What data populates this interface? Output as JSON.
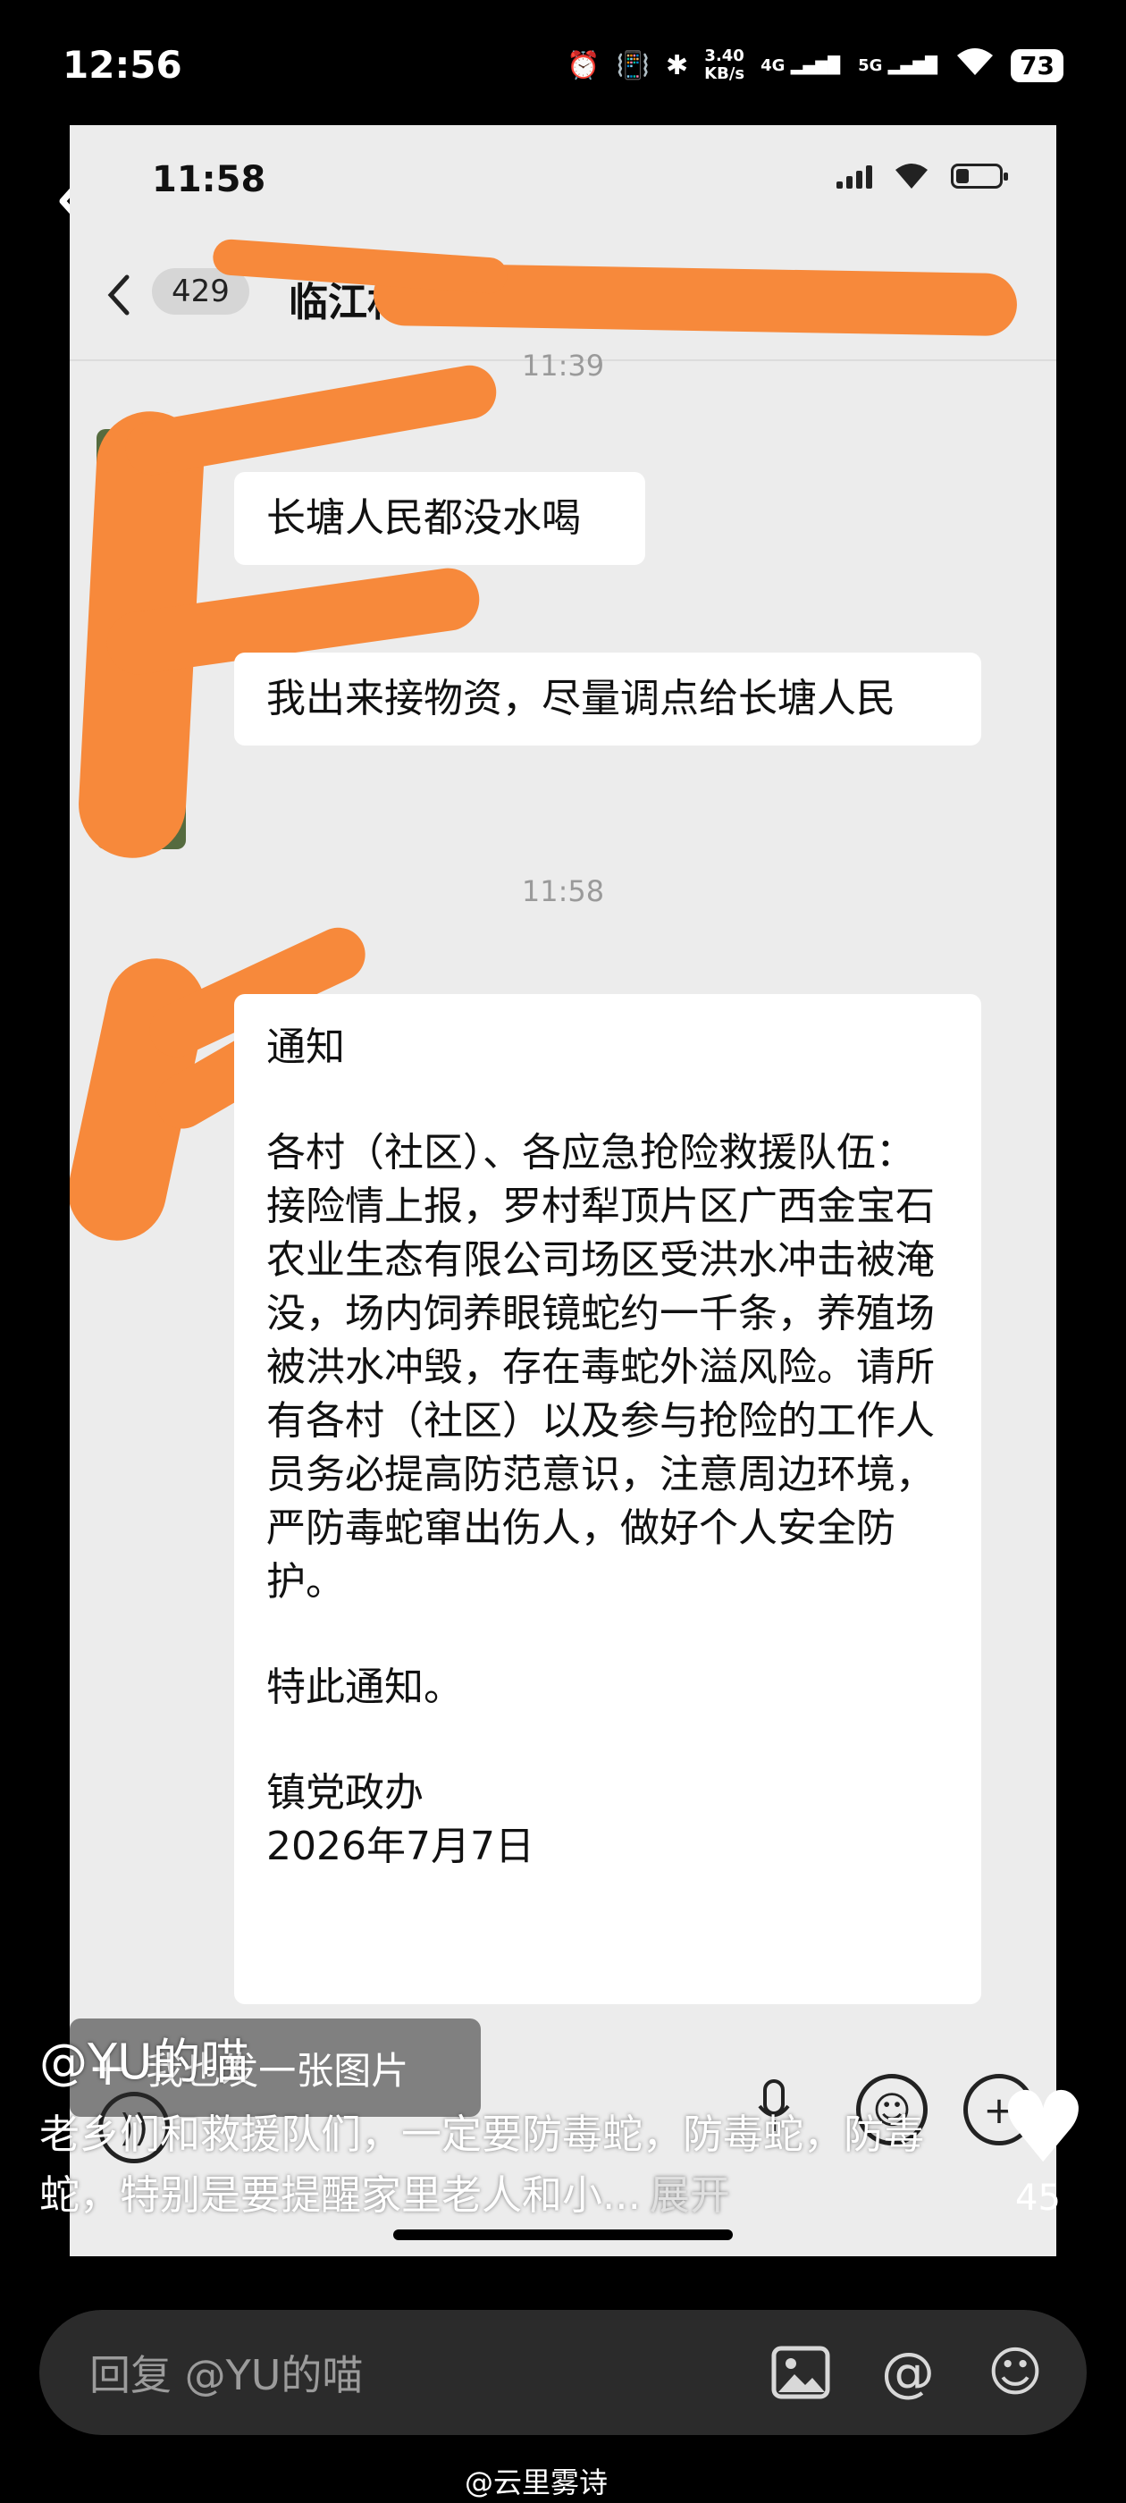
{
  "outer_status": {
    "time": "12:56",
    "speed_value": "3.40",
    "speed_unit": "KB/s",
    "net1": "4G",
    "net2": "5G",
    "battery": "73"
  },
  "inner_status": {
    "time": "11:58"
  },
  "chat": {
    "unread_count": "429",
    "title": "临江村委",
    "timestamps": [
      "11:39",
      "11:58"
    ],
    "messages": [
      {
        "text": "长塘人民都没水喝"
      },
      {
        "text": "我出来接物资，尽量调点给长塘人民"
      },
      {
        "lines": [
          "通知",
          "",
          "各村（社区）、各应急抢险救援队伍：",
          "接险情上报，罗村犁顶片区广西金宝石农业生态有限公司场区受洪水冲击被淹没，场内饲养眼镜蛇约一千条，养殖场被洪水冲毁，存在毒蛇外溢风险。请所有各村（社区）以及参与抢险的工作人员务必提高防范意识，注意周边环境，严防毒蛇窜出伤人，做好个人安全防护。",
          "",
          "特此通知。",
          "",
          "镇党政办",
          "2026年7月7日"
        ]
      }
    ]
  },
  "overlay": {
    "post_image_label": "我也发一张图片",
    "author": "@YU的喵",
    "description": "老乡们和救援队们，一定要防毒蛇，防毒蛇，防毒蛇，特别是要提醒家里老人和小...",
    "expand_label": "展开",
    "likes": "45"
  },
  "reply_bar": {
    "placeholder": "回复 @YU的喵"
  },
  "watermark": "@云里雾诗",
  "icons": [
    "back-icon",
    "more-icon",
    "voice-icon",
    "mic-icon",
    "emoji-icon",
    "plus-icon",
    "heart-icon",
    "image-icon",
    "at-icon"
  ]
}
